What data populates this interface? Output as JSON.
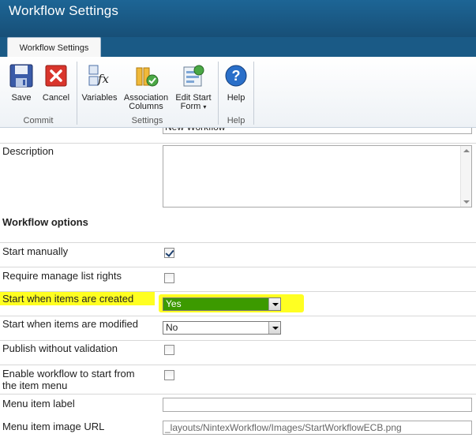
{
  "window": {
    "title": "Workflow Settings"
  },
  "tab": {
    "label": "Workflow Settings"
  },
  "ribbon": {
    "commit": {
      "label": "Commit",
      "save": "Save",
      "cancel": "Cancel"
    },
    "settings": {
      "label": "Settings",
      "variables": "Variables",
      "association_1": "Association",
      "association_2": "Columns",
      "edit_start_1": "Edit Start",
      "edit_start_2": "Form"
    },
    "help": {
      "label": "Help",
      "help": "Help"
    }
  },
  "form": {
    "title_value": "New Workflow",
    "description_label": "Description",
    "workflow_options_label": "Workflow options",
    "start_manually_label": "Start manually",
    "start_manually_checked": true,
    "require_rights_label": "Require manage list rights",
    "require_rights_checked": false,
    "start_created_label": "Start when items are created",
    "start_created_value": "Yes",
    "start_modified_label": "Start when items are modified",
    "start_modified_value": "No",
    "publish_label": "Publish without validation",
    "publish_checked": false,
    "enable_menu_label_1": "Enable workflow to start from",
    "enable_menu_label_2": "the item menu",
    "enable_menu_checked": false,
    "menu_item_label": "Menu item label",
    "menu_item_value": "",
    "menu_image_label": "Menu item image URL",
    "menu_image_value": "_layouts/NintexWorkflow/Images/StartWorkflowECB.png"
  },
  "colors": {
    "titlebar": "#195a84",
    "highlight": "#ffff22",
    "selected_option": "#3c9a00"
  }
}
